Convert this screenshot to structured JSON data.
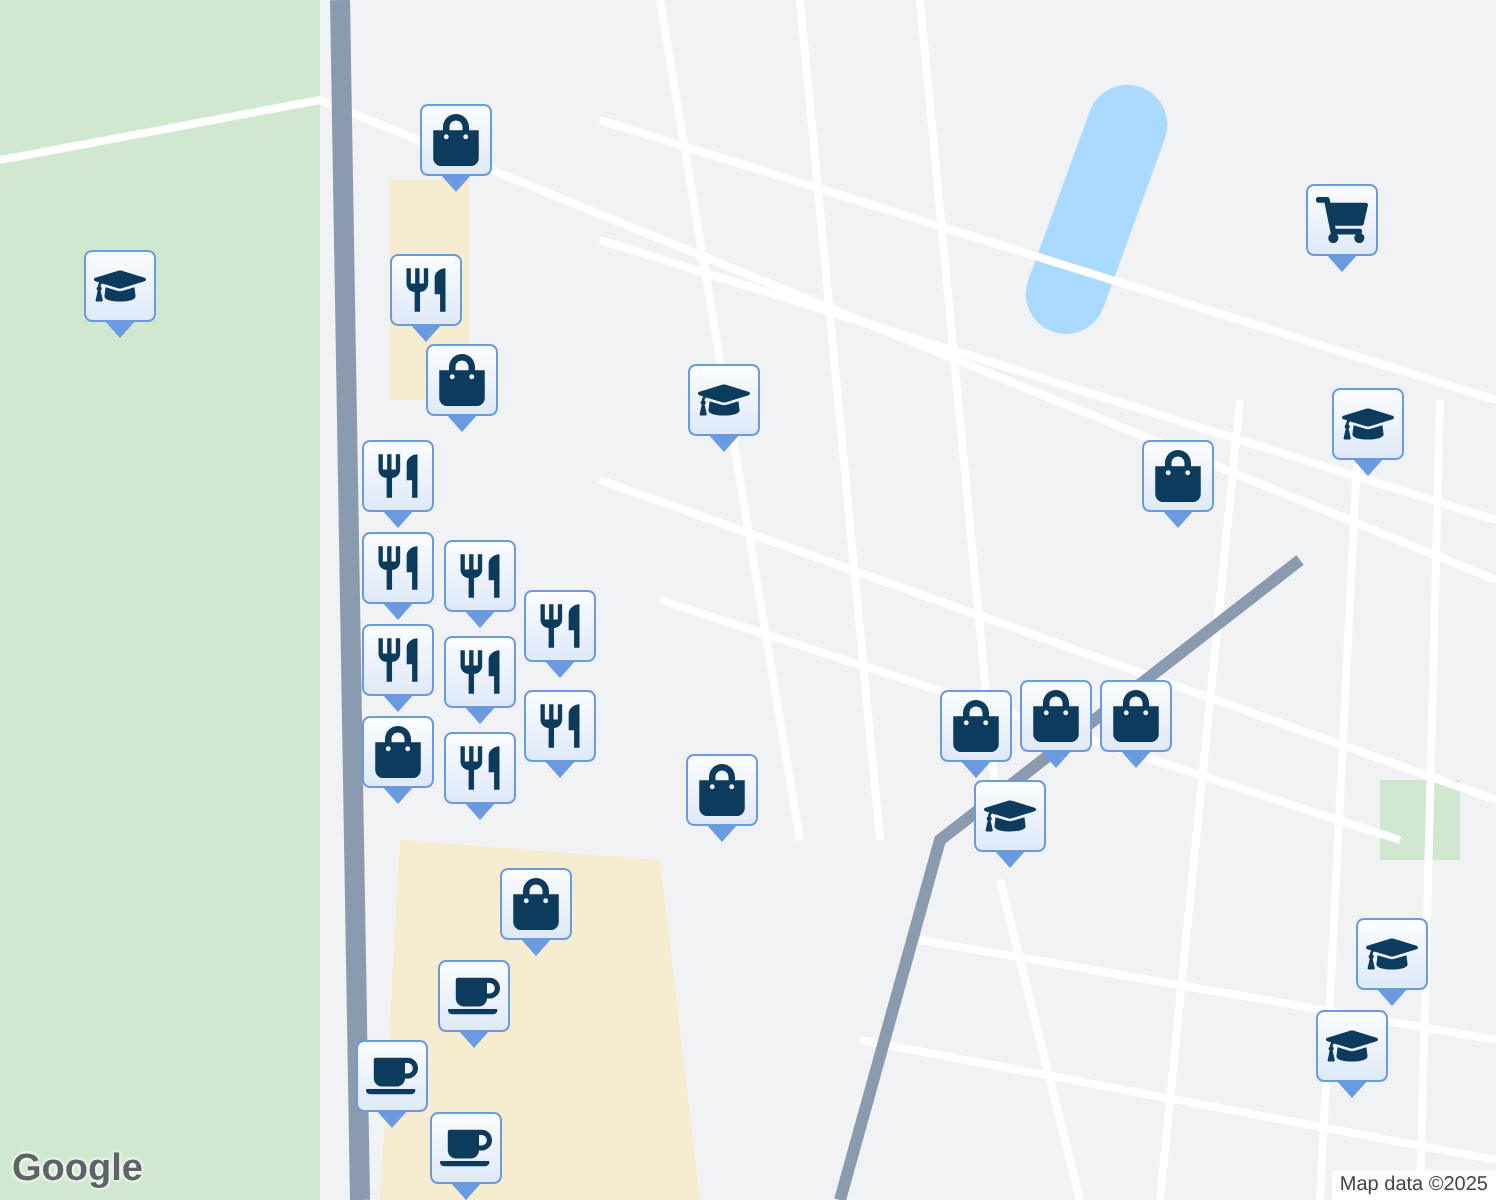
{
  "map": {
    "pins": [
      {
        "kind": "shopping"
      },
      {
        "kind": "school"
      },
      {
        "kind": "restaurant"
      },
      {
        "kind": "shopping"
      },
      {
        "kind": "school"
      },
      {
        "kind": "restaurant"
      },
      {
        "kind": "restaurant"
      },
      {
        "kind": "restaurant"
      },
      {
        "kind": "restaurant"
      },
      {
        "kind": "restaurant"
      },
      {
        "kind": "restaurant"
      },
      {
        "kind": "shopping"
      },
      {
        "kind": "restaurant"
      },
      {
        "kind": "restaurant"
      },
      {
        "kind": "shopping"
      },
      {
        "kind": "shopping"
      },
      {
        "kind": "shopping"
      },
      {
        "kind": "shopping"
      },
      {
        "kind": "school"
      },
      {
        "kind": "shopping"
      },
      {
        "kind": "grocery"
      },
      {
        "kind": "school"
      },
      {
        "kind": "shopping"
      },
      {
        "kind": "cafe"
      },
      {
        "kind": "cafe"
      },
      {
        "kind": "cafe"
      },
      {
        "kind": "school"
      },
      {
        "kind": "school"
      }
    ]
  },
  "logo": "Google",
  "attribution": "Map data ©2025"
}
